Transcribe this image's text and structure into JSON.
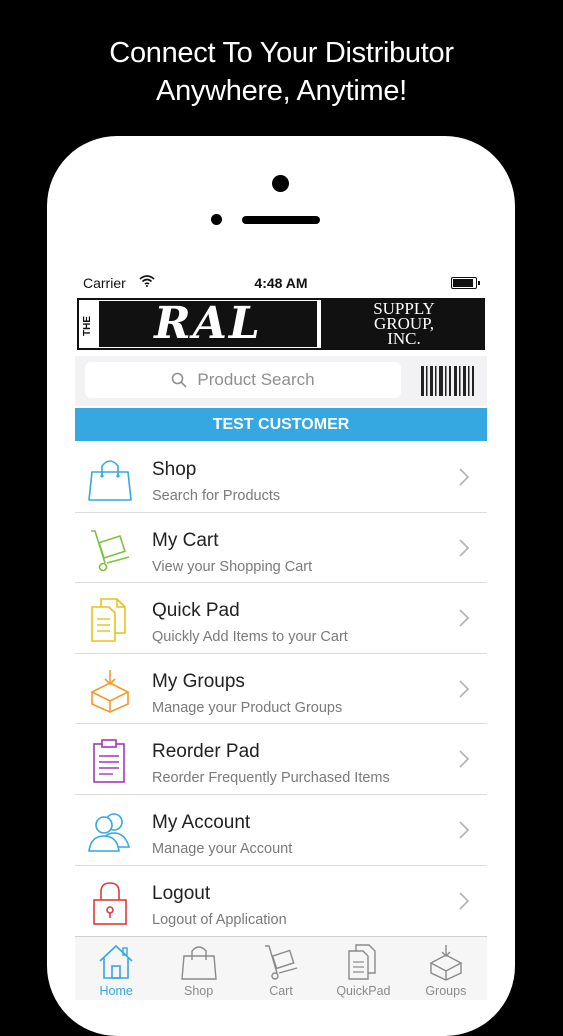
{
  "headline": {
    "line1": "Connect To Your Distributor",
    "line2": "Anywhere, Anytime!"
  },
  "status_bar": {
    "carrier": "Carrier",
    "time": "4:48 AM"
  },
  "logo": {
    "the": "THE",
    "ral": "RAL",
    "line1": "SUPPLY",
    "line2": "GROUP,",
    "line3": "INC."
  },
  "search": {
    "placeholder": "Product Search"
  },
  "customer": {
    "name": "TEST CUSTOMER"
  },
  "menu": [
    {
      "title": "Shop",
      "subtitle": "Search for Products",
      "icon": "shopping-bag-icon",
      "color": "#35a7e1"
    },
    {
      "title": "My Cart",
      "subtitle": "View your Shopping Cart",
      "icon": "hand-truck-icon",
      "color": "#7dc142"
    },
    {
      "title": "Quick Pad",
      "subtitle": "Quickly Add Items to your Cart",
      "icon": "documents-icon",
      "color": "#e8c21a"
    },
    {
      "title": "My Groups",
      "subtitle": "Manage your Product Groups",
      "icon": "box-download-icon",
      "color": "#f39a2a"
    },
    {
      "title": "Reorder Pad",
      "subtitle": "Reorder Frequently Purchased Items",
      "icon": "clipboard-icon",
      "color": "#a13bb3"
    },
    {
      "title": "My Account",
      "subtitle": "Manage your Account",
      "icon": "users-icon",
      "color": "#35a7e1"
    },
    {
      "title": "Logout",
      "subtitle": "Logout of Application",
      "icon": "lock-icon",
      "color": "#e03a3a"
    }
  ],
  "tabs": [
    {
      "label": "Home",
      "icon": "home-icon",
      "active": true
    },
    {
      "label": "Shop",
      "icon": "shopping-bag-icon",
      "active": false
    },
    {
      "label": "Cart",
      "icon": "hand-truck-icon",
      "active": false
    },
    {
      "label": "QuickPad",
      "icon": "documents-icon",
      "active": false
    },
    {
      "label": "Groups",
      "icon": "box-download-icon",
      "active": false
    }
  ],
  "colors": {
    "accent": "#35a7e1",
    "background": "#000000"
  }
}
